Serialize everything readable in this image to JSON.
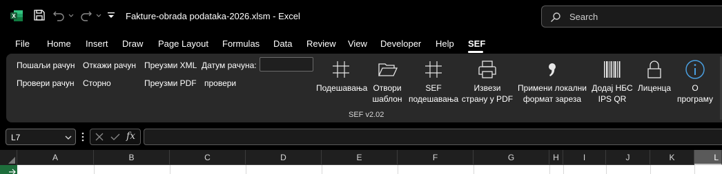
{
  "titlebar": {
    "document_title": "Fakture-obrada podataka-2026.xlsm  -  Excel",
    "search_placeholder": "Search",
    "icons": [
      "excel-logo",
      "save-icon",
      "undo-icon",
      "redo-icon",
      "customize-qat-icon",
      "search-icon"
    ]
  },
  "tabs": [
    "File",
    "Home",
    "Insert",
    "Draw",
    "Page Layout",
    "Formulas",
    "Data",
    "Review",
    "View",
    "Developer",
    "Help",
    "SEF"
  ],
  "active_tab": "SEF",
  "ribbon": {
    "small_buttons": {
      "send_invoice": "Пошаљи рачун",
      "cancel_invoice": "Откажи рачун",
      "download_xml": "Преузми XML",
      "date_label": "Датум рачуна:",
      "check_invoice": "Провери рачун",
      "storno": "Сторно",
      "download_pdf": "Преузми PDF",
      "check": "провери"
    },
    "date_value": "",
    "large_buttons": {
      "settings": "Подешавања",
      "open_template_1": "Отвори",
      "open_template_2": "шаблон",
      "sef_settings_1": "SEF",
      "sef_settings_2": "подешавања",
      "export_pdf_1": "Извези",
      "export_pdf_2": "страну у PDF",
      "apply_format_1": "Примени локални",
      "apply_format_2": "формат зареза",
      "add_qr_1": "Додај НБС",
      "add_qr_2": "IPS QR",
      "license": "Лиценца",
      "about_1": "О",
      "about_2": "програму"
    },
    "group_name": "SEF v2.02"
  },
  "formula_bar": {
    "name_box": "L7",
    "fx": "fx",
    "formula": ""
  },
  "columns": [
    "A",
    "B",
    "C",
    "D",
    "E",
    "F",
    "G",
    "H",
    "I",
    "J",
    "K",
    "L"
  ],
  "selected_column": "L",
  "colors": {
    "accent": "#1e6e3c",
    "ribbon_bg": "#292929",
    "info_icon": "#4a9fe0"
  }
}
